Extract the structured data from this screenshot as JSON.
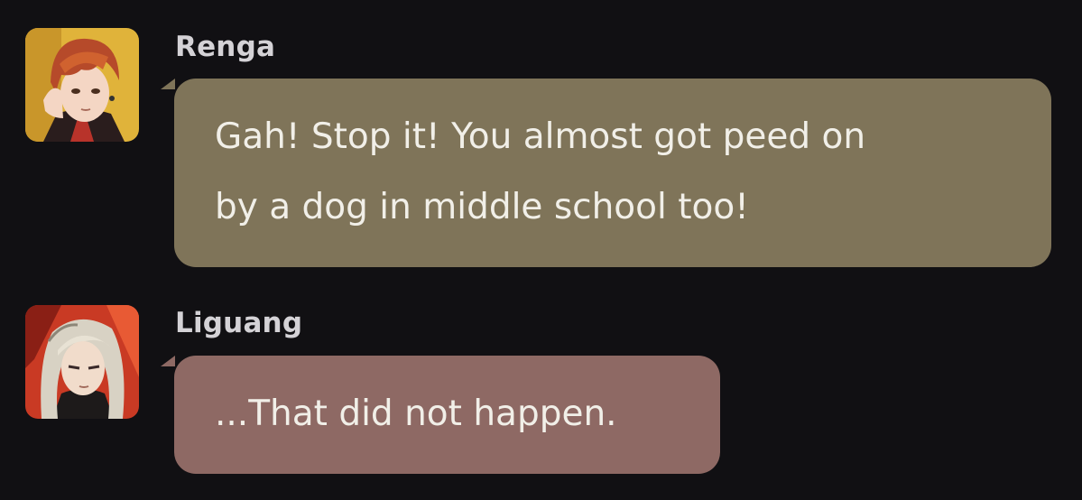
{
  "messages": [
    {
      "sender": "Renga",
      "avatar_icon": "renga-avatar-icon",
      "bubble_color": "#7f7459",
      "lines": [
        "Gah! Stop it! You almost got peed on",
        "by a dog in middle school too!"
      ]
    },
    {
      "sender": "Liguang",
      "avatar_icon": "liguang-avatar-icon",
      "bubble_color": "#8e6964",
      "lines": [
        "...That did not happen."
      ]
    }
  ],
  "colors": {
    "background": "#111013",
    "name_text": "#d4d2d6",
    "bubble_text": "#f1efe8"
  }
}
